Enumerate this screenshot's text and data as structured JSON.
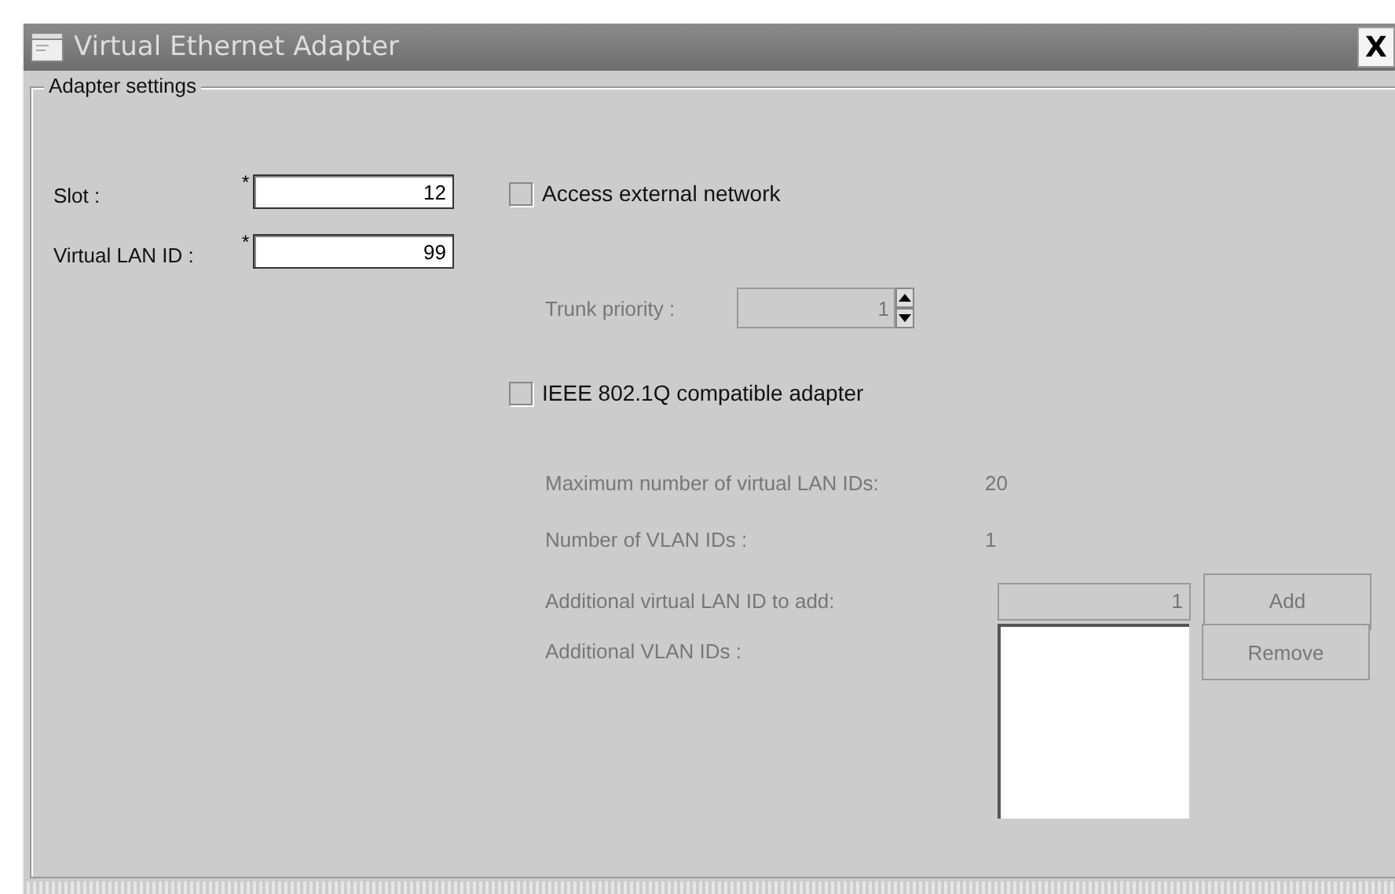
{
  "window": {
    "title": "Virtual Ethernet Adapter",
    "close": "X"
  },
  "group": {
    "title": "Adapter settings"
  },
  "fields": [
    {
      "label": "Slot :",
      "required": true,
      "value": "12"
    },
    {
      "label": "Virtual LAN ID :",
      "required": true,
      "value": "99"
    }
  ],
  "required_mark": "*",
  "access_external": {
    "label": "Access external network",
    "checked": false
  },
  "trunk_priority": {
    "label": "Trunk priority :",
    "value": "1",
    "disabled": true
  },
  "ieee": {
    "label": "IEEE 802.1Q compatible adapter",
    "checked": false
  },
  "vlan": {
    "disabled": true,
    "max_label": "Maximum number of virtual LAN IDs:",
    "max_value": "20",
    "count_label": "Number of VLAN IDs :",
    "count_value": "1",
    "add_label": "Additional virtual LAN ID to add:",
    "add_value": "1",
    "add_button": "Add",
    "list_label": "Additional VLAN IDs :",
    "remove_button": "Remove"
  }
}
